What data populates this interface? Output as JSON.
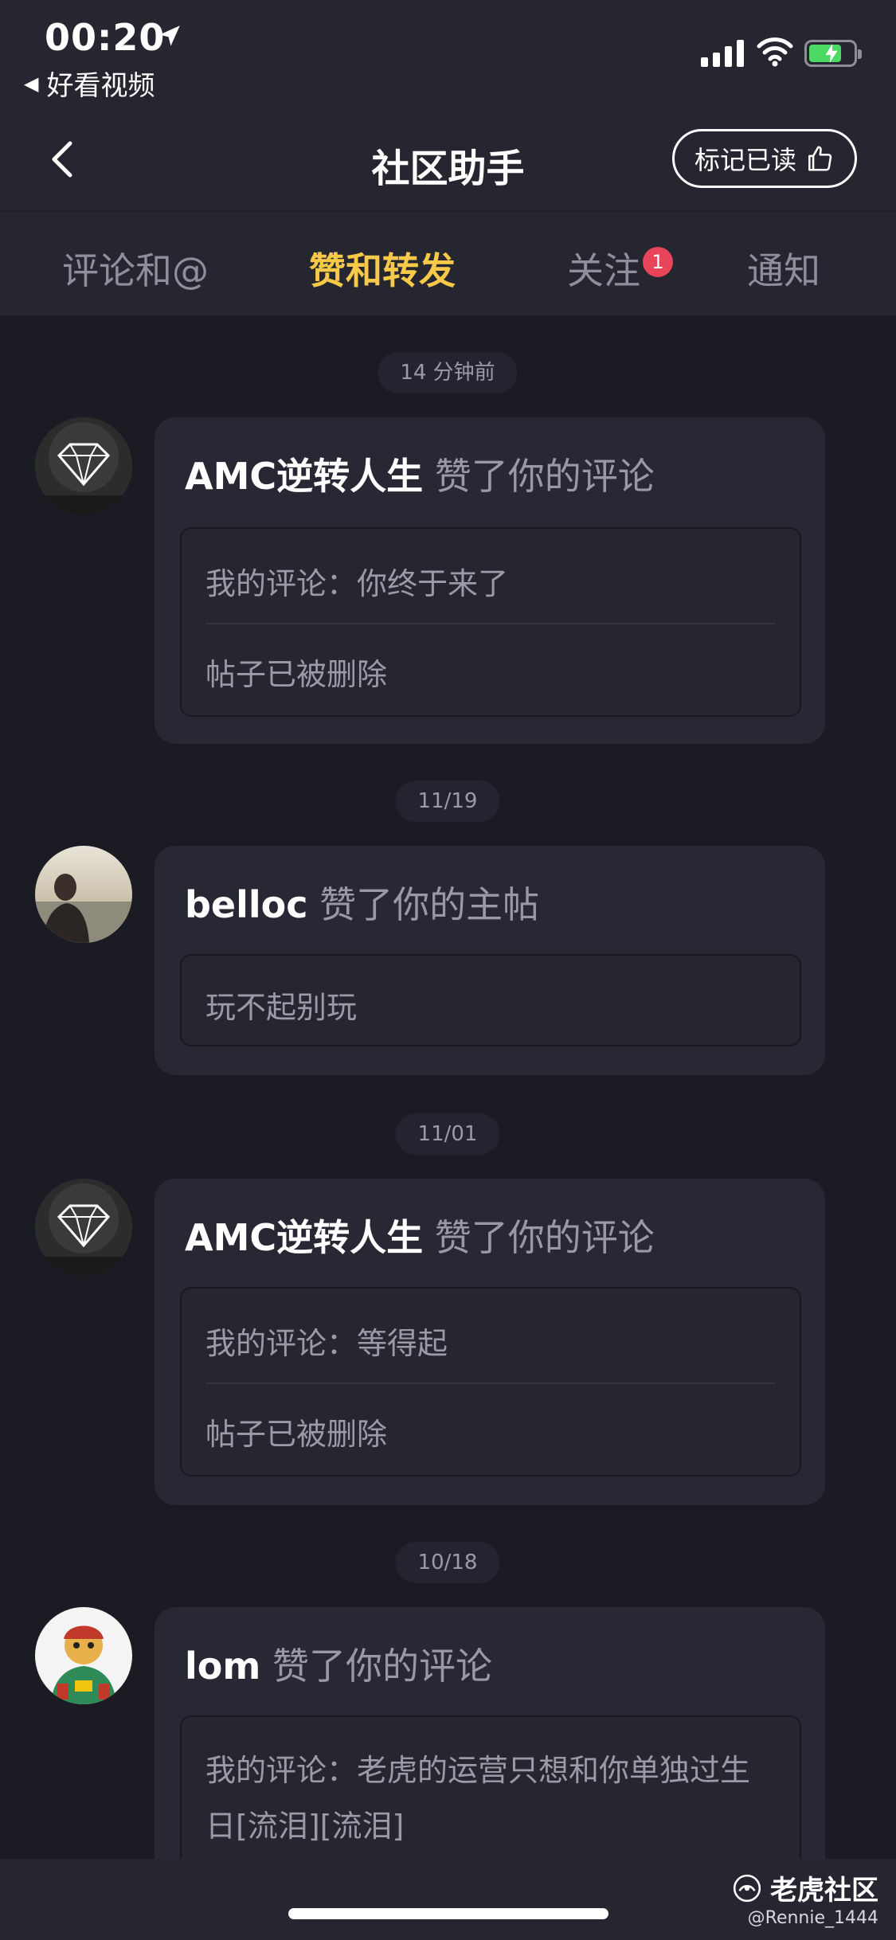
{
  "status_bar": {
    "time": "00:20",
    "back_app_label": "好看视频",
    "icons": [
      "location-arrow-icon",
      "cellular-signal-icon",
      "wifi-icon",
      "battery-charging-icon"
    ],
    "battery_color": "#4cd964"
  },
  "header": {
    "title": "社区助手",
    "mark_read_label": "标记已读"
  },
  "tabs": [
    {
      "label": "评论和@",
      "active": false
    },
    {
      "label": "赞和转发",
      "active": true
    },
    {
      "label": "关注",
      "active": false,
      "badge": "1"
    },
    {
      "label": "通知",
      "active": false
    }
  ],
  "colors": {
    "accent": "#f7c948",
    "badge": "#e8455a",
    "background": "#1b1b24",
    "card": "#282834"
  },
  "feed": [
    {
      "timestamp": "14 分钟前",
      "user": "AMC逆转人生",
      "action": "赞了你的评论",
      "avatar": "diamond-avatar",
      "quote_lines": [
        "我的评论：你终于来了",
        "帖子已被删除"
      ]
    },
    {
      "timestamp": "11/19",
      "user": "belloc",
      "action": "赞了你的主帖",
      "avatar": "photo-avatar",
      "quote_lines": [
        "玩不起别玩"
      ]
    },
    {
      "timestamp": "11/01",
      "user": "AMC逆转人生",
      "action": "赞了你的评论",
      "avatar": "diamond-avatar",
      "quote_lines": [
        "我的评论：等得起",
        "帖子已被删除"
      ]
    },
    {
      "timestamp": "10/18",
      "user": "lom",
      "action": "赞了你的评论",
      "avatar": "cartoon-avatar",
      "quote_lines": [
        "我的评论：老虎的运营只想和你单独过生",
        "日[流泪][流泪]"
      ]
    }
  ],
  "watermark": {
    "brand": "老虎社区",
    "handle": "@Rennie_1444"
  }
}
